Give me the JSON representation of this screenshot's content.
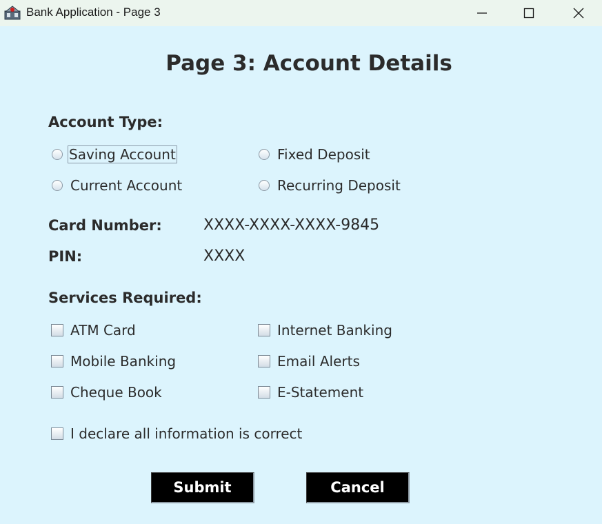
{
  "window": {
    "title": "Bank Application - Page 3",
    "controls": [
      "minimize",
      "maximize",
      "close"
    ]
  },
  "page": {
    "heading": "Page 3: Account Details"
  },
  "account_type": {
    "label": "Account Type:",
    "options": [
      {
        "label": "Saving Account",
        "selected": false,
        "focused": true
      },
      {
        "label": "Fixed Deposit",
        "selected": false
      },
      {
        "label": "Current Account",
        "selected": false
      },
      {
        "label": "Recurring Deposit",
        "selected": false
      }
    ]
  },
  "card": {
    "label": "Card Number:",
    "value": "XXXX-XXXX-XXXX-9845"
  },
  "pin": {
    "label": "PIN:",
    "value": "XXXX"
  },
  "services": {
    "label": "Services Required:",
    "options": [
      {
        "label": "ATM Card",
        "checked": false
      },
      {
        "label": "Internet Banking",
        "checked": false
      },
      {
        "label": "Mobile Banking",
        "checked": false
      },
      {
        "label": "Email Alerts",
        "checked": false
      },
      {
        "label": "Cheque Book",
        "checked": false
      },
      {
        "label": "E-Statement",
        "checked": false
      }
    ]
  },
  "declaration": {
    "label": "I declare all information is correct",
    "checked": false
  },
  "buttons": {
    "submit": "Submit",
    "cancel": "Cancel"
  },
  "colors": {
    "background": "#dcf4fd",
    "titlebar": "#ecf5ee",
    "button_bg": "#000000",
    "button_text": "#ffffff"
  }
}
